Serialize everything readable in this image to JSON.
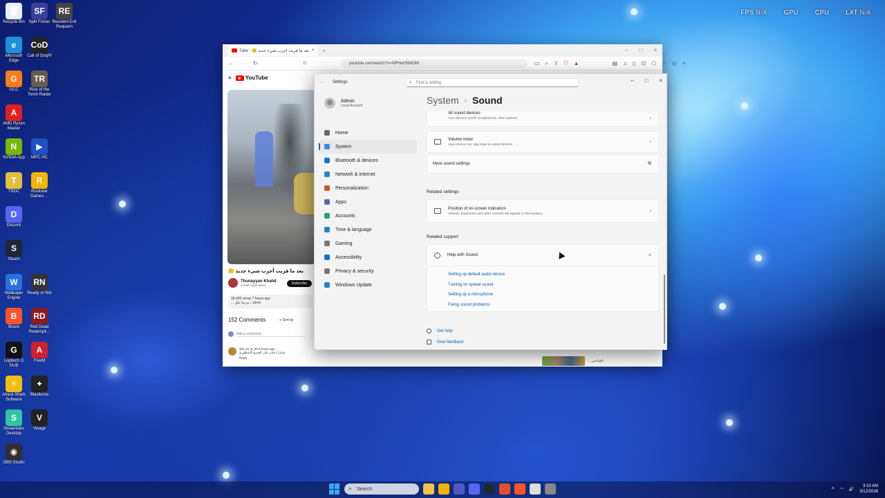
{
  "overlay": {
    "fps_label": "FPS",
    "fps_value": "N/A",
    "gpu_label": "GPU",
    "cpu_label": "CPU",
    "lat_label": "LAT",
    "lat_value": "N/A"
  },
  "desktop_icons": [
    {
      "label": "Recycle Bin",
      "color": "#e8eef8",
      "glyph": "🗑"
    },
    {
      "label": "Split Fiction",
      "color": "#3a3f9a",
      "glyph": "SF"
    },
    {
      "label": "Resident Evil Requiem",
      "color": "#444",
      "glyph": "RE"
    },
    {
      "label": "Microsoft Edge",
      "color": "#1f8fd8",
      "glyph": "e"
    },
    {
      "label": "Call of Duty®",
      "color": "#222",
      "glyph": "CoD"
    },
    {
      "label": "GCC",
      "color": "#ff7a1a",
      "glyph": "G"
    },
    {
      "label": "Rise of the Tomb Raider",
      "color": "#6b5b4e",
      "glyph": "TR"
    },
    {
      "label": "AMD Ryzen Master",
      "color": "#e02020",
      "glyph": "A"
    },
    {
      "label": "NVIDIA App",
      "color": "#76b900",
      "glyph": "N"
    },
    {
      "label": "MPC-HC",
      "color": "#2050c0",
      "glyph": "▶"
    },
    {
      "label": "TRDC",
      "color": "#e0c040",
      "glyph": "T"
    },
    {
      "label": "Rockstar Games ...",
      "color": "#f4b400",
      "glyph": "R"
    },
    {
      "label": "Discord",
      "color": "#5865f2",
      "glyph": "D"
    },
    {
      "label": "Steam",
      "color": "#1b2838",
      "glyph": "S"
    },
    {
      "label": "Wallpaper Engine",
      "color": "#2a6ee0",
      "glyph": "W"
    },
    {
      "label": "Ready or Not",
      "color": "#333",
      "glyph": "RN"
    },
    {
      "label": "Brave",
      "color": "#fb542b",
      "glyph": "B"
    },
    {
      "label": "Red Dead Redempti...",
      "color": "#8a1c1c",
      "glyph": "RD"
    },
    {
      "label": "Logitech G HUB",
      "color": "#111",
      "glyph": "G"
    },
    {
      "label": "FiveM",
      "color": "#d0202c",
      "glyph": "A"
    },
    {
      "label": "Attack Shark Software",
      "color": "#f0c010",
      "glyph": "⚡"
    },
    {
      "label": "Blasfemia",
      "color": "#222",
      "glyph": "✦"
    },
    {
      "label": "Streamlabs Desktop",
      "color": "#31c3a2",
      "glyph": "S"
    },
    {
      "label": "Visage",
      "color": "#222",
      "glyph": "V"
    },
    {
      "label": "OBS Studio",
      "color": "#302e31",
      "glyph": "◉"
    }
  ],
  "browser": {
    "tab_title": "بعد ما قربت أجرب شيء جديد 🤫 - YouTube",
    "url": "youtube.com/watch?v=NPHwh5bltOM",
    "yt_logo": "YouTube",
    "video_title": "بعد ما قربت أجرب شيء جديد 🤫",
    "channel_name": "Thunayyan Khalid",
    "channel_subs": "3.93M subscribers",
    "subscribe": "Subscribe",
    "views": "18,445 views  7 hours ago",
    "desc": "... مرحبا بكل  ...more",
    "comments_count": "152 Comments",
    "sort_by": "Sort by",
    "add_comment": "Add a comment...",
    "comment_user": "@S_M_B_00  6 hours ago",
    "comment_text": "شكرا يا فيان على الفيديو الاسطوري",
    "comment_reply": "Reply",
    "rec_title": "الحياة في ..."
  },
  "settings": {
    "window_title": "Settings",
    "search_placeholder": "Find a setting",
    "user_name": "Admin",
    "user_type": "Local Account",
    "nav": [
      {
        "label": "Home",
        "color": "#6a6a6a"
      },
      {
        "label": "System",
        "color": "#3c8dd8"
      },
      {
        "label": "Bluetooth & devices",
        "color": "#1e6fd0"
      },
      {
        "label": "Network & internet",
        "color": "#2a7fd0"
      },
      {
        "label": "Personalization",
        "color": "#c85a20"
      },
      {
        "label": "Apps",
        "color": "#5a6aa8"
      },
      {
        "label": "Accounts",
        "color": "#2aa06a"
      },
      {
        "label": "Time & language",
        "color": "#2a80c8"
      },
      {
        "label": "Gaming",
        "color": "#777777"
      },
      {
        "label": "Accessibility",
        "color": "#1a70c0"
      },
      {
        "label": "Privacy & security",
        "color": "#777777"
      },
      {
        "label": "Windows Update",
        "color": "#2a80d0"
      }
    ],
    "breadcrumb_parent": "System",
    "breadcrumb_sep": "›",
    "breadcrumb_current": "Sound",
    "all_sound_devices_title": "All sound devices",
    "all_sound_devices_desc": "Turn devices on/off, troubleshoot, other options",
    "volume_mixer_title": "Volume mixer",
    "volume_mixer_desc": "App volume mix, app input & output devices",
    "more_sound_settings": "More sound settings",
    "related_settings_header": "Related settings",
    "osd_title": "Position of on-screen indicators",
    "osd_desc": "Volume, brightness and other controls will appear in this location",
    "related_support_header": "Related support",
    "help_title": "Help with Sound",
    "help_links": [
      "Setting up default audio device",
      "Turning on spatial sound",
      "Setting up a microphone",
      "Fixing sound problems"
    ],
    "get_help": "Get help",
    "give_feedback": "Give feedback"
  },
  "taskbar": {
    "search_placeholder": "Search",
    "time": "3:10 AM",
    "date": "3/12/2026",
    "apps": [
      {
        "name": "file-explorer",
        "color": "#f2c14e"
      },
      {
        "name": "files",
        "color": "#f0b400"
      },
      {
        "name": "teams",
        "color": "#5059c9"
      },
      {
        "name": "discord",
        "color": "#5865f2"
      },
      {
        "name": "steam",
        "color": "#1b2838"
      },
      {
        "name": "media-player",
        "color": "#e0502a"
      },
      {
        "name": "brave",
        "color": "#fb542b"
      },
      {
        "name": "chrome",
        "color": "#dddddd"
      },
      {
        "name": "settings",
        "color": "#888888"
      }
    ]
  }
}
